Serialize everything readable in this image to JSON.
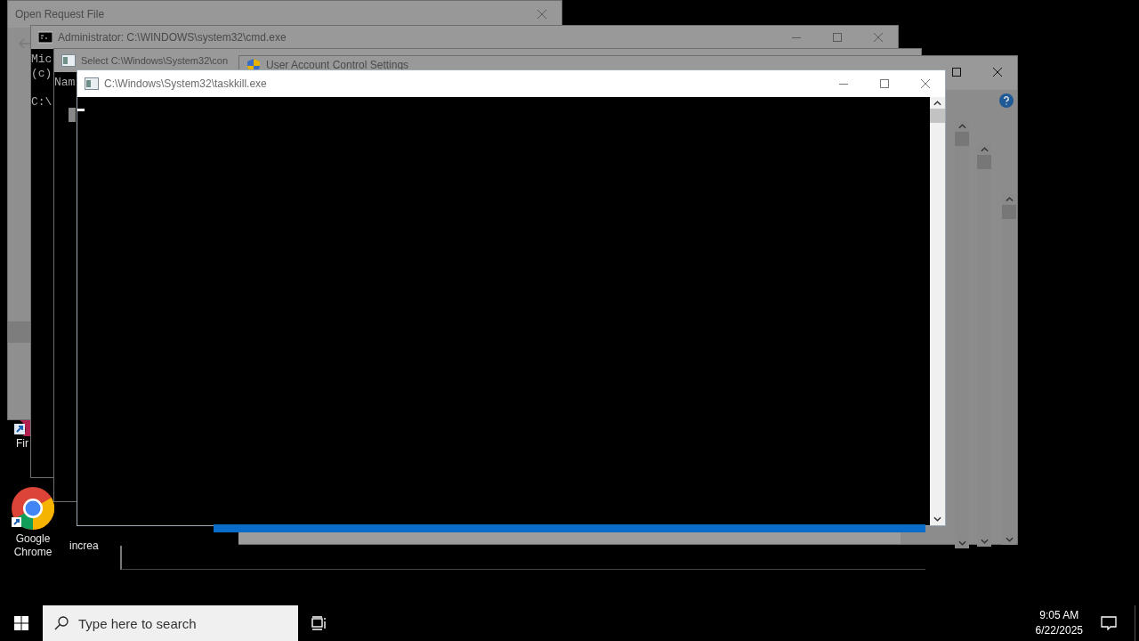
{
  "desktop_icons": [
    {
      "label": "Fir"
    },
    {
      "label": "Google Chrome"
    },
    {
      "label": "increa"
    }
  ],
  "windows": [
    {
      "kind": "dialog",
      "title": "Open Request File",
      "active": false
    },
    {
      "kind": "console",
      "title": "Administrator: C:\\WINDOWS\\system32\\cmd.exe",
      "active": false,
      "paragraphs": [
        [
          "Mic",
          "(c)"
        ],
        [
          "C:\\"
        ]
      ]
    },
    {
      "kind": "console",
      "title": "Select C:\\Windows\\System32\\con",
      "active": false,
      "paragraphs": [
        [
          "Nam"
        ]
      ]
    },
    {
      "kind": "settings",
      "title": "User Account Control Settings",
      "active": false
    },
    {
      "kind": "console",
      "title": "C:\\Windows\\System32\\taskkill.exe",
      "active": true,
      "scrollbar": true
    }
  ],
  "taskbar": {
    "search": {
      "placeholder": "Type here to search"
    },
    "clock": {
      "time": "9:05 AM",
      "date": "6/22/2025"
    }
  }
}
